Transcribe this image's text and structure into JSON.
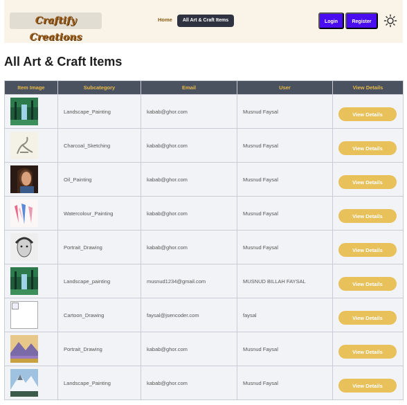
{
  "navbar": {
    "brand": "Craftify Creations",
    "home": "Home",
    "all_items": "All Art & Craft Items",
    "login": "Login",
    "register": "Register",
    "theme_icon": "sun-icon"
  },
  "page": {
    "title": "All Art & Craft Items"
  },
  "table": {
    "headers": [
      "Item Image",
      "Subcategory",
      "Email",
      "User",
      "View Details"
    ],
    "rows": [
      {
        "image": "landscape-painting-thumbnail",
        "subcategory": "Landscape_Painting",
        "email": "kabab@ghor.com",
        "user": "Musnud Faysal",
        "action": "View Details"
      },
      {
        "image": "charcoal-sketch-thumbnail",
        "subcategory": "Charcoal_Sketching",
        "email": "kabab@ghor.com",
        "user": "Musnud Faysal",
        "action": "View Details"
      },
      {
        "image": "oil-portrait-thumbnail",
        "subcategory": "Oil_Painting",
        "email": "kabab@ghor.com",
        "user": "Musnud Faysal",
        "action": "View Details"
      },
      {
        "image": "watercolour-thumbnail",
        "subcategory": "Watercolour_Painting",
        "email": "kabab@ghor.com",
        "user": "Musnud Faysal",
        "action": "View Details"
      },
      {
        "image": "portrait-drawing-thumbnail",
        "subcategory": "Portrait_Drawing",
        "email": "kabab@ghor.com",
        "user": "Musnud Faysal",
        "action": "View Details"
      },
      {
        "image": "landscape-painting-thumbnail",
        "subcategory": "Landscape_painting",
        "email": "musnud1234@gmail.com",
        "user": "MUSNUD BILLAH FAYSAL",
        "action": "View Details"
      },
      {
        "image": "broken-image",
        "subcategory": "Cartoon_Drawing",
        "email": "faysal@jsencoder.com",
        "user": "faysal",
        "action": "View Details"
      },
      {
        "image": "mountain-painting-thumbnail",
        "subcategory": "Portrait_Drawing",
        "email": "kabab@ghor.com",
        "user": "Musnud Faysal",
        "action": "View Details"
      },
      {
        "image": "snowy-mountain-thumbnail",
        "subcategory": "Landscape_Painting",
        "email": "kabab@ghor.com",
        "user": "Musnud Faysal",
        "action": "View Details"
      }
    ]
  },
  "colors": {
    "nav_bg": "#faf4e8",
    "primary_button": "#4a0df2",
    "table_header_bg": "#4a5260",
    "table_header_text": "#e8b84a",
    "details_button": "#e8c15a"
  }
}
